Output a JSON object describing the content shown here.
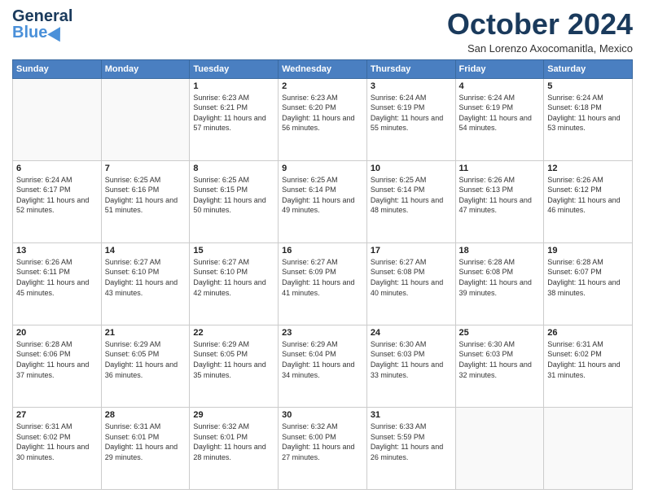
{
  "header": {
    "logo_line1": "General",
    "logo_line2": "Blue",
    "month": "October 2024",
    "location": "San Lorenzo Axocomanitla, Mexico"
  },
  "weekdays": [
    "Sunday",
    "Monday",
    "Tuesday",
    "Wednesday",
    "Thursday",
    "Friday",
    "Saturday"
  ],
  "weeks": [
    [
      {
        "day": "",
        "sunrise": "",
        "sunset": "",
        "daylight": ""
      },
      {
        "day": "",
        "sunrise": "",
        "sunset": "",
        "daylight": ""
      },
      {
        "day": "1",
        "sunrise": "Sunrise: 6:23 AM",
        "sunset": "Sunset: 6:21 PM",
        "daylight": "Daylight: 11 hours and 57 minutes."
      },
      {
        "day": "2",
        "sunrise": "Sunrise: 6:23 AM",
        "sunset": "Sunset: 6:20 PM",
        "daylight": "Daylight: 11 hours and 56 minutes."
      },
      {
        "day": "3",
        "sunrise": "Sunrise: 6:24 AM",
        "sunset": "Sunset: 6:19 PM",
        "daylight": "Daylight: 11 hours and 55 minutes."
      },
      {
        "day": "4",
        "sunrise": "Sunrise: 6:24 AM",
        "sunset": "Sunset: 6:19 PM",
        "daylight": "Daylight: 11 hours and 54 minutes."
      },
      {
        "day": "5",
        "sunrise": "Sunrise: 6:24 AM",
        "sunset": "Sunset: 6:18 PM",
        "daylight": "Daylight: 11 hours and 53 minutes."
      }
    ],
    [
      {
        "day": "6",
        "sunrise": "Sunrise: 6:24 AM",
        "sunset": "Sunset: 6:17 PM",
        "daylight": "Daylight: 11 hours and 52 minutes."
      },
      {
        "day": "7",
        "sunrise": "Sunrise: 6:25 AM",
        "sunset": "Sunset: 6:16 PM",
        "daylight": "Daylight: 11 hours and 51 minutes."
      },
      {
        "day": "8",
        "sunrise": "Sunrise: 6:25 AM",
        "sunset": "Sunset: 6:15 PM",
        "daylight": "Daylight: 11 hours and 50 minutes."
      },
      {
        "day": "9",
        "sunrise": "Sunrise: 6:25 AM",
        "sunset": "Sunset: 6:14 PM",
        "daylight": "Daylight: 11 hours and 49 minutes."
      },
      {
        "day": "10",
        "sunrise": "Sunrise: 6:25 AM",
        "sunset": "Sunset: 6:14 PM",
        "daylight": "Daylight: 11 hours and 48 minutes."
      },
      {
        "day": "11",
        "sunrise": "Sunrise: 6:26 AM",
        "sunset": "Sunset: 6:13 PM",
        "daylight": "Daylight: 11 hours and 47 minutes."
      },
      {
        "day": "12",
        "sunrise": "Sunrise: 6:26 AM",
        "sunset": "Sunset: 6:12 PM",
        "daylight": "Daylight: 11 hours and 46 minutes."
      }
    ],
    [
      {
        "day": "13",
        "sunrise": "Sunrise: 6:26 AM",
        "sunset": "Sunset: 6:11 PM",
        "daylight": "Daylight: 11 hours and 45 minutes."
      },
      {
        "day": "14",
        "sunrise": "Sunrise: 6:27 AM",
        "sunset": "Sunset: 6:10 PM",
        "daylight": "Daylight: 11 hours and 43 minutes."
      },
      {
        "day": "15",
        "sunrise": "Sunrise: 6:27 AM",
        "sunset": "Sunset: 6:10 PM",
        "daylight": "Daylight: 11 hours and 42 minutes."
      },
      {
        "day": "16",
        "sunrise": "Sunrise: 6:27 AM",
        "sunset": "Sunset: 6:09 PM",
        "daylight": "Daylight: 11 hours and 41 minutes."
      },
      {
        "day": "17",
        "sunrise": "Sunrise: 6:27 AM",
        "sunset": "Sunset: 6:08 PM",
        "daylight": "Daylight: 11 hours and 40 minutes."
      },
      {
        "day": "18",
        "sunrise": "Sunrise: 6:28 AM",
        "sunset": "Sunset: 6:08 PM",
        "daylight": "Daylight: 11 hours and 39 minutes."
      },
      {
        "day": "19",
        "sunrise": "Sunrise: 6:28 AM",
        "sunset": "Sunset: 6:07 PM",
        "daylight": "Daylight: 11 hours and 38 minutes."
      }
    ],
    [
      {
        "day": "20",
        "sunrise": "Sunrise: 6:28 AM",
        "sunset": "Sunset: 6:06 PM",
        "daylight": "Daylight: 11 hours and 37 minutes."
      },
      {
        "day": "21",
        "sunrise": "Sunrise: 6:29 AM",
        "sunset": "Sunset: 6:05 PM",
        "daylight": "Daylight: 11 hours and 36 minutes."
      },
      {
        "day": "22",
        "sunrise": "Sunrise: 6:29 AM",
        "sunset": "Sunset: 6:05 PM",
        "daylight": "Daylight: 11 hours and 35 minutes."
      },
      {
        "day": "23",
        "sunrise": "Sunrise: 6:29 AM",
        "sunset": "Sunset: 6:04 PM",
        "daylight": "Daylight: 11 hours and 34 minutes."
      },
      {
        "day": "24",
        "sunrise": "Sunrise: 6:30 AM",
        "sunset": "Sunset: 6:03 PM",
        "daylight": "Daylight: 11 hours and 33 minutes."
      },
      {
        "day": "25",
        "sunrise": "Sunrise: 6:30 AM",
        "sunset": "Sunset: 6:03 PM",
        "daylight": "Daylight: 11 hours and 32 minutes."
      },
      {
        "day": "26",
        "sunrise": "Sunrise: 6:31 AM",
        "sunset": "Sunset: 6:02 PM",
        "daylight": "Daylight: 11 hours and 31 minutes."
      }
    ],
    [
      {
        "day": "27",
        "sunrise": "Sunrise: 6:31 AM",
        "sunset": "Sunset: 6:02 PM",
        "daylight": "Daylight: 11 hours and 30 minutes."
      },
      {
        "day": "28",
        "sunrise": "Sunrise: 6:31 AM",
        "sunset": "Sunset: 6:01 PM",
        "daylight": "Daylight: 11 hours and 29 minutes."
      },
      {
        "day": "29",
        "sunrise": "Sunrise: 6:32 AM",
        "sunset": "Sunset: 6:01 PM",
        "daylight": "Daylight: 11 hours and 28 minutes."
      },
      {
        "day": "30",
        "sunrise": "Sunrise: 6:32 AM",
        "sunset": "Sunset: 6:00 PM",
        "daylight": "Daylight: 11 hours and 27 minutes."
      },
      {
        "day": "31",
        "sunrise": "Sunrise: 6:33 AM",
        "sunset": "Sunset: 5:59 PM",
        "daylight": "Daylight: 11 hours and 26 minutes."
      },
      {
        "day": "",
        "sunrise": "",
        "sunset": "",
        "daylight": ""
      },
      {
        "day": "",
        "sunrise": "",
        "sunset": "",
        "daylight": ""
      }
    ]
  ]
}
